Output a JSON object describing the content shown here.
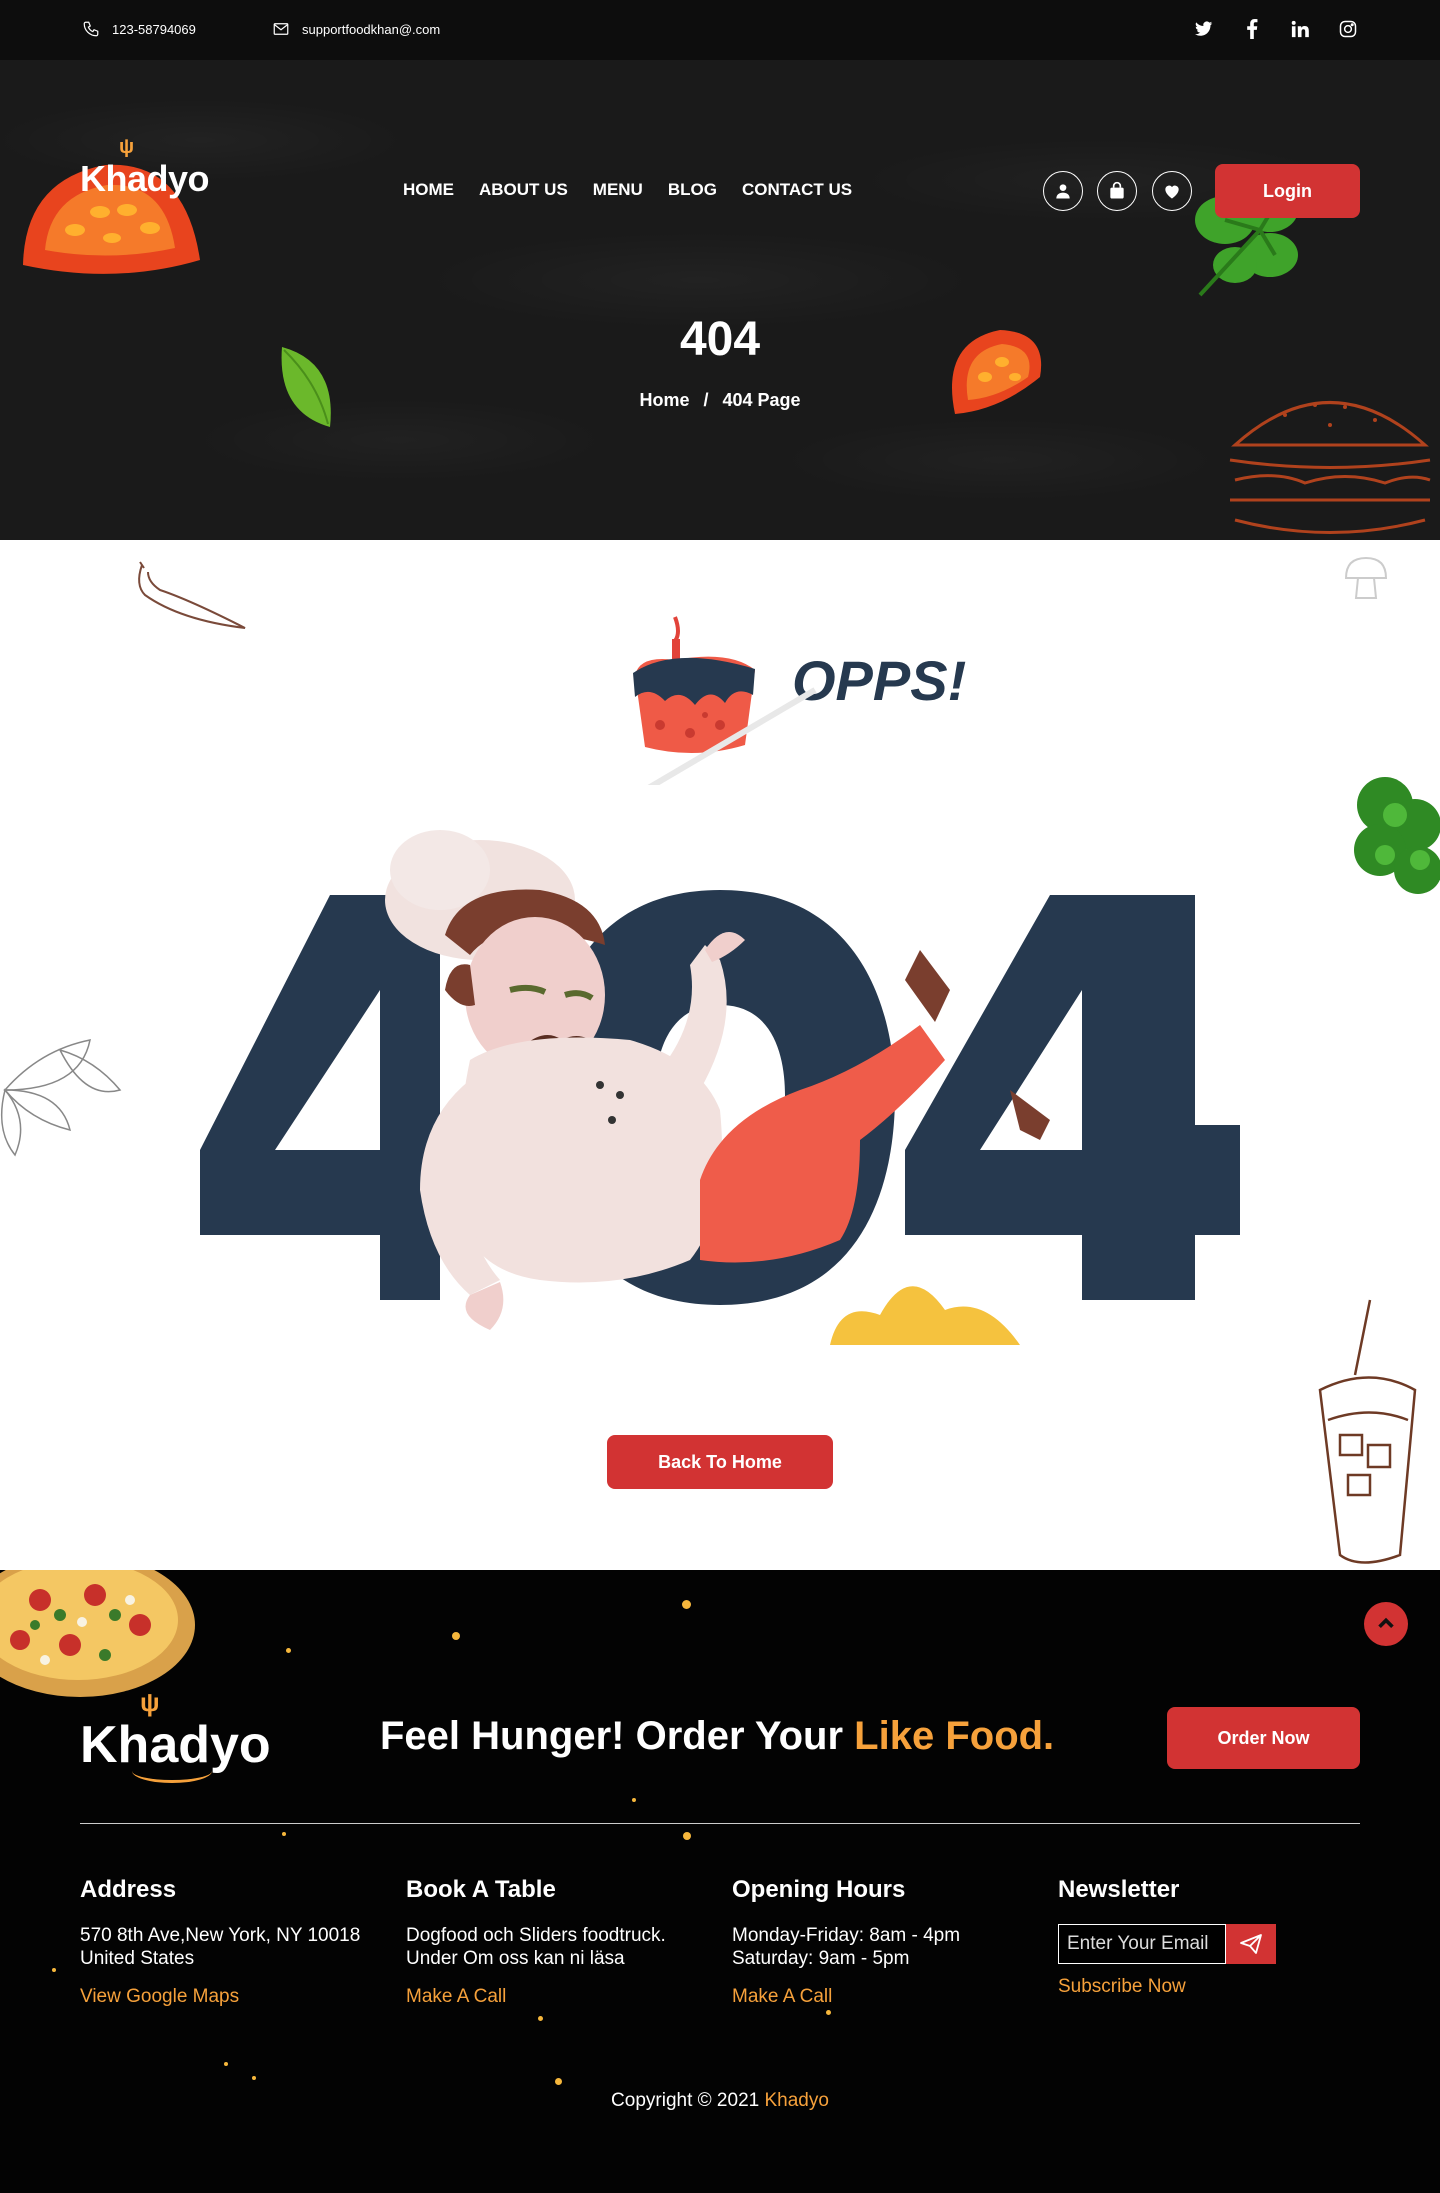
{
  "topbar": {
    "phone": "123-58794069",
    "email": "supportfoodkhan@.com",
    "socials": [
      {
        "name": "twitter-icon",
        "glyph": "𝕥"
      },
      {
        "name": "facebook-icon",
        "glyph": "f"
      },
      {
        "name": "linkedin-icon",
        "glyph": "in"
      },
      {
        "name": "instagram-icon",
        "glyph": "◎"
      }
    ]
  },
  "header": {
    "logo": "Khadyo",
    "nav": [
      "HOME",
      "ABOUT US",
      "MENU",
      "BLOG",
      "CONTACT US"
    ],
    "login_label": "Login"
  },
  "hero": {
    "title": "404",
    "breadcrumb_home": "Home",
    "breadcrumb_sep": "/",
    "breadcrumb_current": "404 Page"
  },
  "error": {
    "opps": "OPPS!",
    "back_label": "Back To Home"
  },
  "footer": {
    "logo": "Khadyo",
    "tagline_main": "Feel Hunger! Order Your ",
    "tagline_highlight": "Like Food.",
    "order_label": "Order Now",
    "address": {
      "title": "Address",
      "line1": "570 8th Ave,New York, NY 10018",
      "line2": "United States",
      "link": "View Google Maps"
    },
    "book": {
      "title": "Book A Table",
      "line1": "Dogfood och Sliders foodtruck.",
      "line2": "Under Om oss kan ni läsa",
      "link": "Make A Call"
    },
    "hours": {
      "title": "Opening Hours",
      "line1": "Monday-Friday: 8am - 4pm",
      "line2": "Saturday: 9am - 5pm",
      "link": "Make A Call"
    },
    "newsletter": {
      "title": "Newsletter",
      "placeholder": "Enter Your Email",
      "link": "Subscribe Now"
    },
    "copyright_prefix": "Copyright ",
    "copyright_symbol": "©",
    "copyright_year": " 2021 ",
    "copyright_brand": "Khadyo"
  },
  "colors": {
    "accent_red": "#d23333",
    "accent_orange": "#f6a13b",
    "navy": "#26394f",
    "dark": "#1a1a1a"
  }
}
